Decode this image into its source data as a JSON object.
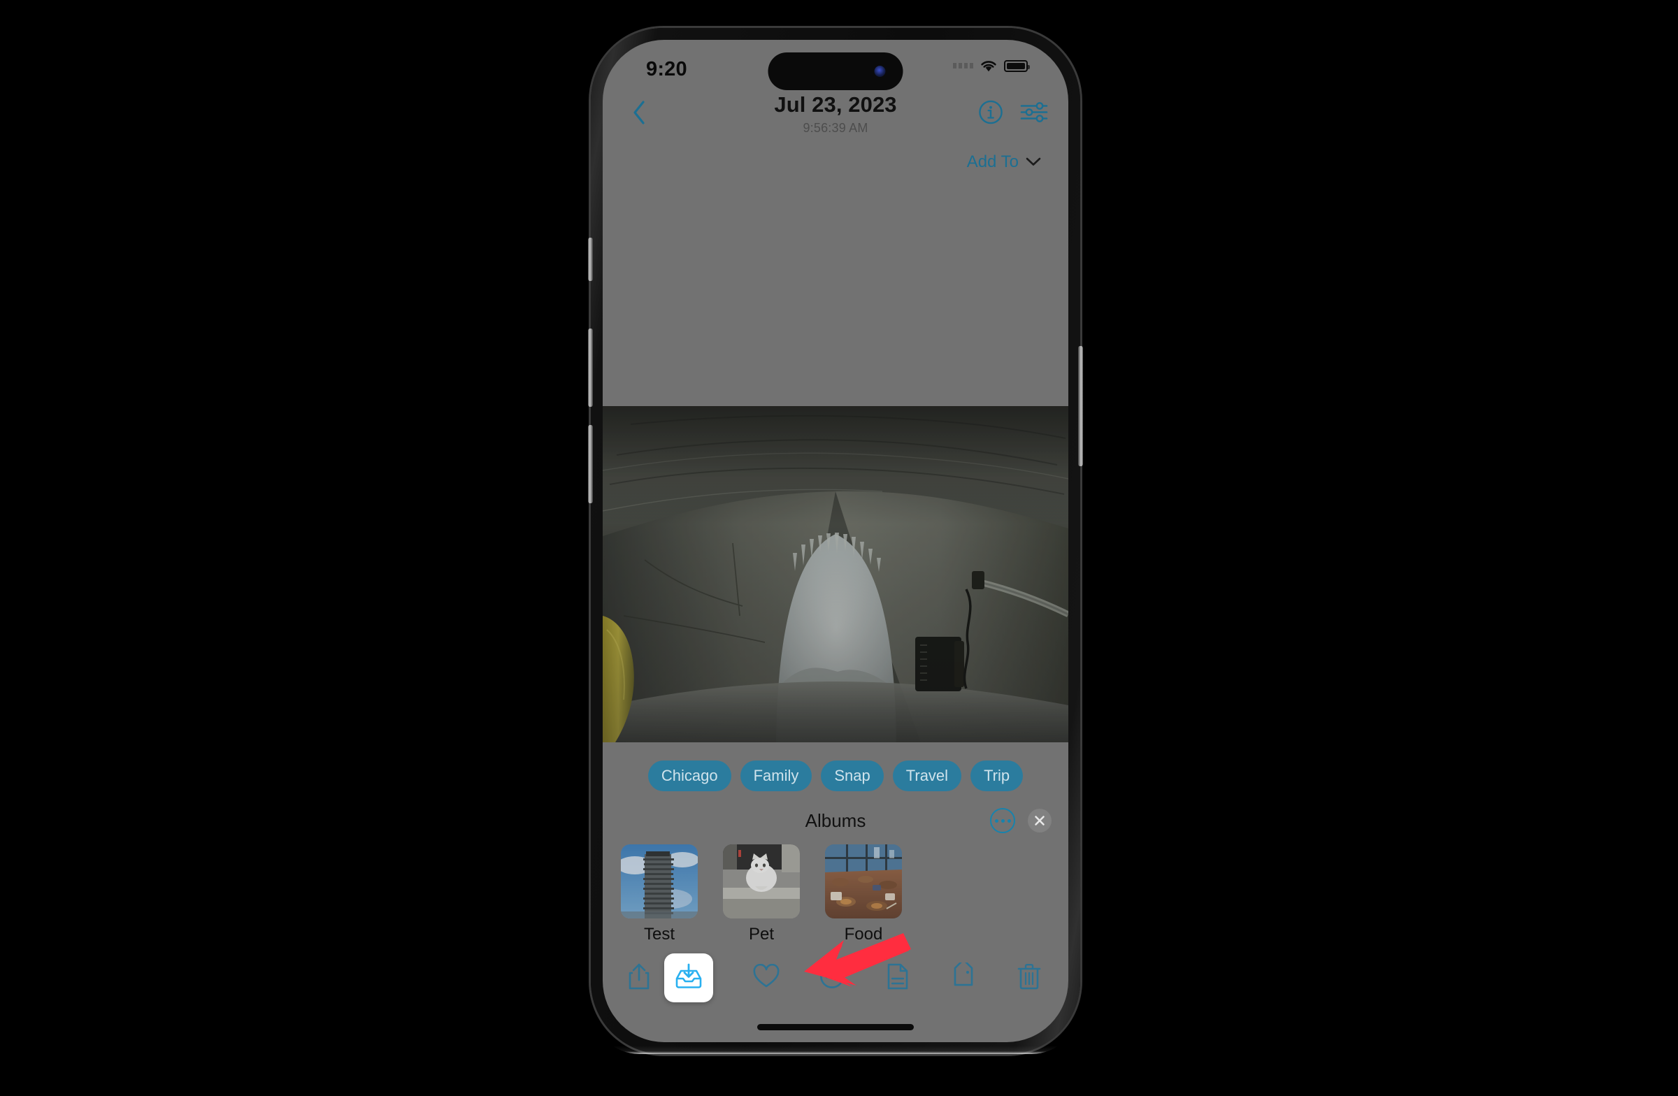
{
  "device": {
    "name": "iphone-15-pro",
    "side_buttons": [
      "action-button",
      "volume-up-button",
      "volume-down-button",
      "power-button"
    ]
  },
  "status_bar": {
    "time": "9:20",
    "signal_icon": "cellular-signal-icon",
    "wifi_icon": "wifi-icon",
    "battery_icon": "battery-icon"
  },
  "nav": {
    "back_icon": "chevron-left-icon",
    "date": "Jul 23, 2023",
    "time": "9:56:39 AM",
    "info_icon": "info-circle-icon",
    "adjust_icon": "sliders-icon"
  },
  "add_to": {
    "label": "Add To",
    "chevron_icon": "chevron-down-icon"
  },
  "photo": {
    "alt": "dark stone tunnel with arched opening",
    "description": "Dark concrete tunnel interior with an arched opening revealing bright foggy daylight, a yellow object at left and a black electrical junction box mounted on the right wall."
  },
  "tags": [
    {
      "label": "Chicago"
    },
    {
      "label": "Family"
    },
    {
      "label": "Snap"
    },
    {
      "label": "Travel"
    },
    {
      "label": "Trip"
    }
  ],
  "albums_panel": {
    "title": "Albums",
    "more_icon": "ellipsis-circle-icon",
    "close_icon": "close-icon",
    "items": [
      {
        "label": "Test",
        "thumb": "skyscraper-thumbnail"
      },
      {
        "label": "Pet",
        "thumb": "white-cat-thumbnail"
      },
      {
        "label": "Food",
        "thumb": "dining-table-thumbnail"
      }
    ]
  },
  "toolbar": {
    "items": [
      {
        "name": "share-button",
        "icon": "share-icon",
        "highlighted": false
      },
      {
        "name": "download-button",
        "icon": "tray-download-icon",
        "highlighted": true
      },
      {
        "name": "favorite-button",
        "icon": "heart-icon",
        "highlighted": false
      },
      {
        "name": "more-button",
        "icon": "ellipsis-circle-icon",
        "highlighted": false
      },
      {
        "name": "notes-button",
        "icon": "document-icon",
        "highlighted": false
      },
      {
        "name": "tag-button",
        "icon": "tag-icon",
        "highlighted": false
      },
      {
        "name": "delete-button",
        "icon": "trash-icon",
        "highlighted": false
      }
    ]
  },
  "annotation": {
    "arrow_color": "#FF2D3F",
    "points_to": "download-button"
  },
  "colors": {
    "background": "#000000",
    "screen_overlay_gray": "#727272",
    "accent_teal": "#1c6f92",
    "tag_fill": "#2b7c9e",
    "highlight_blue": "#29b0f0",
    "annotation_red": "#FF2D3F"
  }
}
